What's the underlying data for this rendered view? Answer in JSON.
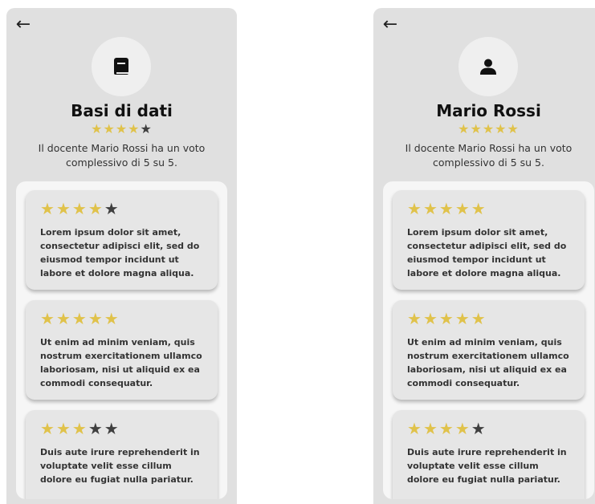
{
  "colors": {
    "star_filled": "#e0c24a",
    "star_empty": "#3f3f3f",
    "background": "#e0e0e0",
    "card": "#e6e6e6"
  },
  "screens": [
    {
      "back_icon": "←",
      "avatar_icon": "book-icon",
      "title": "Basi di dati",
      "rating": 4,
      "subtitle": "Il docente Mario Rossi ha un voto complessivo di 5 su 5.",
      "reviews": [
        {
          "rating": 4,
          "text": "Lorem ipsum dolor sit amet, consectetur adipisci elit, sed do eiusmod tempor incidunt ut labore et dolore magna aliqua."
        },
        {
          "rating": 5,
          "text": "Ut enim ad minim veniam, quis nostrum exercitationem ullamco laboriosam, nisi ut aliquid ex ea commodi consequatur."
        },
        {
          "rating": 3,
          "text": "Duis aute irure reprehenderit in voluptate velit esse cillum dolore eu fugiat nulla pariatur."
        }
      ]
    },
    {
      "back_icon": "←",
      "avatar_icon": "person-icon",
      "title": "Mario Rossi",
      "rating": 5,
      "subtitle": "Il docente Mario Rossi ha un voto complessivo di 5 su 5.",
      "reviews": [
        {
          "rating": 5,
          "text": "Lorem ipsum dolor sit amet, consectetur adipisci elit, sed do eiusmod tempor incidunt ut labore et dolore magna aliqua."
        },
        {
          "rating": 5,
          "text": "Ut enim ad minim veniam, quis nostrum exercitationem ullamco laboriosam, nisi ut aliquid ex ea commodi consequatur."
        },
        {
          "rating": 4,
          "text": "Duis aute irure reprehenderit in voluptate velit esse cillum dolore eu fugiat nulla pariatur."
        }
      ]
    }
  ]
}
